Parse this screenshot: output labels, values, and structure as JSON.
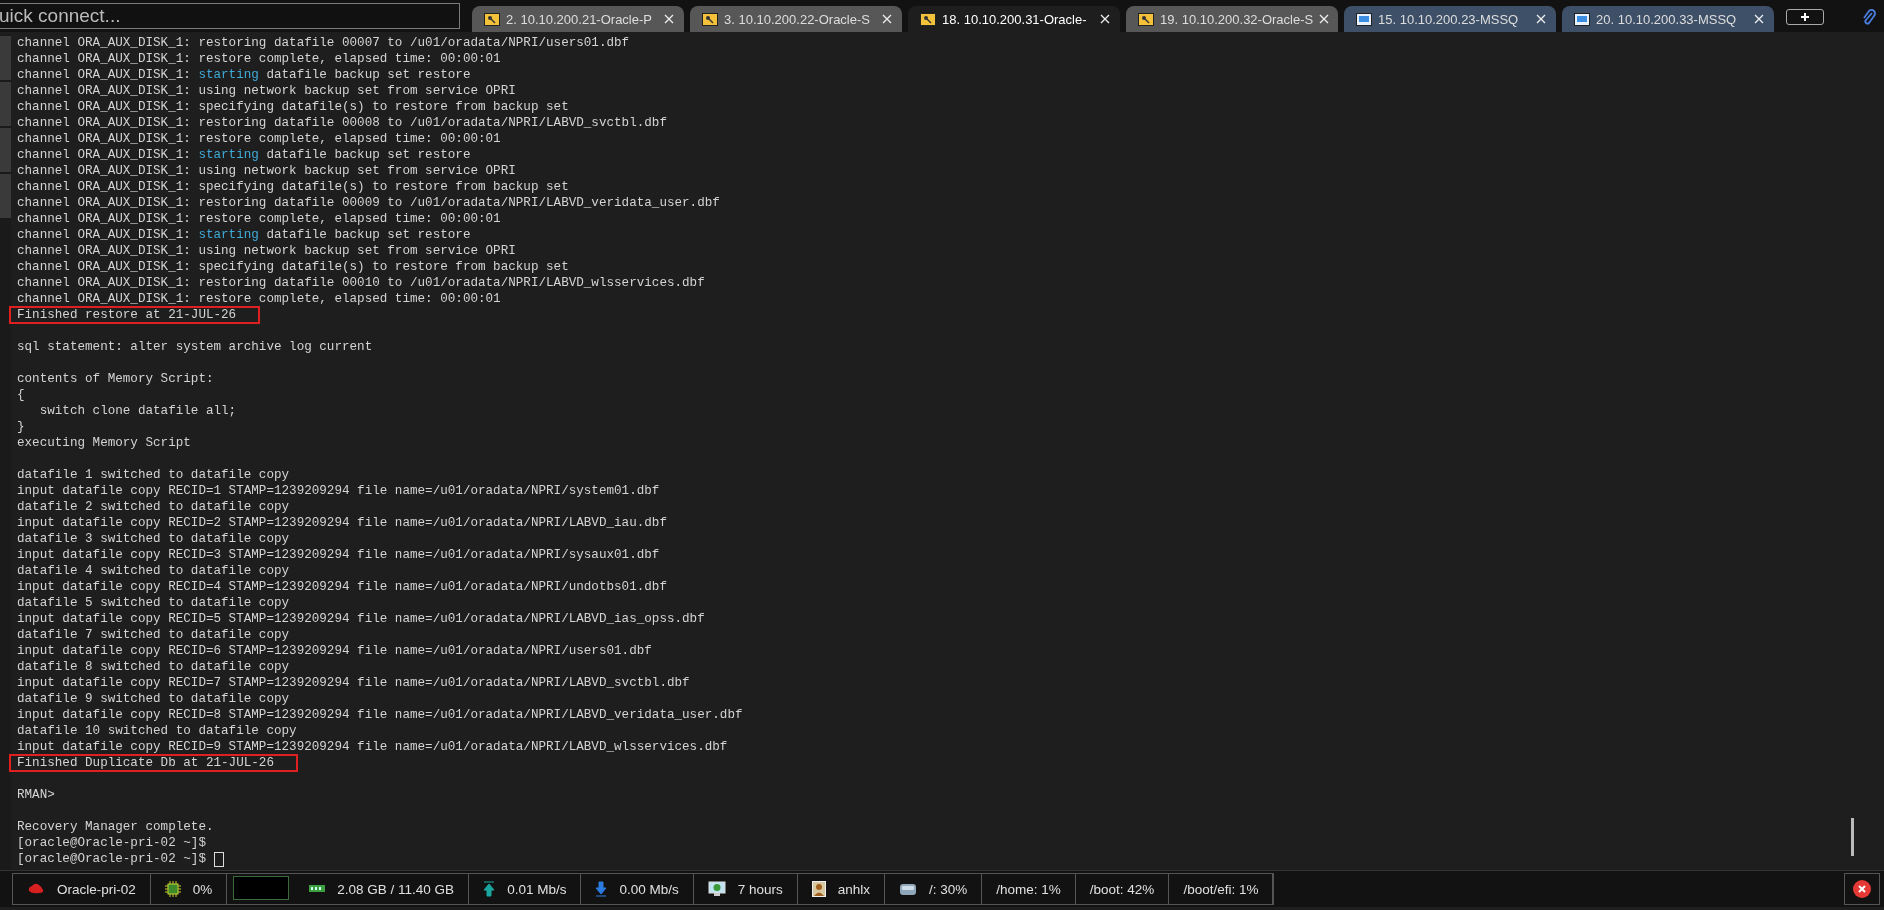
{
  "quick_connect": {
    "placeholder": "uick connect..."
  },
  "tabs": [
    {
      "label": "2. 10.10.200.21-Oracle-P",
      "selected": false,
      "kind": "ssh"
    },
    {
      "label": "3. 10.10.200.22-Oracle-S",
      "selected": false,
      "kind": "ssh"
    },
    {
      "label": "18. 10.10.200.31-Oracle-",
      "selected": true,
      "kind": "ssh"
    },
    {
      "label": "19. 10.10.200.32-Oracle-S",
      "selected": false,
      "kind": "ssh"
    },
    {
      "label": "15. 10.10.200.23-MSSQ",
      "selected": false,
      "kind": "rdp"
    },
    {
      "label": "20. 10.10.200.33-MSSQ",
      "selected": false,
      "kind": "rdp"
    }
  ],
  "terminal": {
    "lines": [
      {
        "kind": "plain",
        "text": "channel ORA_AUX_DISK_1: restoring datafile 00007 to /u01/oradata/NPRI/users01.dbf"
      },
      {
        "kind": "plain",
        "text": "channel ORA_AUX_DISK_1: restore complete, elapsed time: 00:00:01"
      },
      {
        "kind": "keyword",
        "text": "channel ORA_AUX_DISK_1: ",
        "keyword": "starting",
        "rest": " datafile backup set restore"
      },
      {
        "kind": "plain",
        "text": "channel ORA_AUX_DISK_1: using network backup set from service OPRI"
      },
      {
        "kind": "plain",
        "text": "channel ORA_AUX_DISK_1: specifying datafile(s) to restore from backup set"
      },
      {
        "kind": "plain",
        "text": "channel ORA_AUX_DISK_1: restoring datafile 00008 to /u01/oradata/NPRI/LABVD_svctbl.dbf"
      },
      {
        "kind": "plain",
        "text": "channel ORA_AUX_DISK_1: restore complete, elapsed time: 00:00:01"
      },
      {
        "kind": "keyword",
        "text": "channel ORA_AUX_DISK_1: ",
        "keyword": "starting",
        "rest": " datafile backup set restore"
      },
      {
        "kind": "plain",
        "text": "channel ORA_AUX_DISK_1: using network backup set from service OPRI"
      },
      {
        "kind": "plain",
        "text": "channel ORA_AUX_DISK_1: specifying datafile(s) to restore from backup set"
      },
      {
        "kind": "plain",
        "text": "channel ORA_AUX_DISK_1: restoring datafile 00009 to /u01/oradata/NPRI/LABVD_veridata_user.dbf"
      },
      {
        "kind": "plain",
        "text": "channel ORA_AUX_DISK_1: restore complete, elapsed time: 00:00:01"
      },
      {
        "kind": "keyword",
        "text": "channel ORA_AUX_DISK_1: ",
        "keyword": "starting",
        "rest": " datafile backup set restore"
      },
      {
        "kind": "plain",
        "text": "channel ORA_AUX_DISK_1: using network backup set from service OPRI"
      },
      {
        "kind": "plain",
        "text": "channel ORA_AUX_DISK_1: specifying datafile(s) to restore from backup set"
      },
      {
        "kind": "plain",
        "text": "channel ORA_AUX_DISK_1: restoring datafile 00010 to /u01/oradata/NPRI/LABVD_wlsservices.dbf"
      },
      {
        "kind": "plain",
        "text": "channel ORA_AUX_DISK_1: restore complete, elapsed time: 00:00:01"
      },
      {
        "kind": "boxed",
        "text": "Finished restore at 21-JUL-26"
      },
      {
        "kind": "blank"
      },
      {
        "kind": "plain",
        "text": "sql statement: alter system archive log current"
      },
      {
        "kind": "blank"
      },
      {
        "kind": "plain",
        "text": "contents of Memory Script:"
      },
      {
        "kind": "plain",
        "text": "{"
      },
      {
        "kind": "plain",
        "text": "   switch clone datafile all;"
      },
      {
        "kind": "plain",
        "text": "}"
      },
      {
        "kind": "plain",
        "text": "executing Memory Script"
      },
      {
        "kind": "blank"
      },
      {
        "kind": "plain",
        "text": "datafile 1 switched to datafile copy"
      },
      {
        "kind": "plain",
        "text": "input datafile copy RECID=1 STAMP=1239209294 file name=/u01/oradata/NPRI/system01.dbf"
      },
      {
        "kind": "plain",
        "text": "datafile 2 switched to datafile copy"
      },
      {
        "kind": "plain",
        "text": "input datafile copy RECID=2 STAMP=1239209294 file name=/u01/oradata/NPRI/LABVD_iau.dbf"
      },
      {
        "kind": "plain",
        "text": "datafile 3 switched to datafile copy"
      },
      {
        "kind": "plain",
        "text": "input datafile copy RECID=3 STAMP=1239209294 file name=/u01/oradata/NPRI/sysaux01.dbf"
      },
      {
        "kind": "plain",
        "text": "datafile 4 switched to datafile copy"
      },
      {
        "kind": "plain",
        "text": "input datafile copy RECID=4 STAMP=1239209294 file name=/u01/oradata/NPRI/undotbs01.dbf"
      },
      {
        "kind": "plain",
        "text": "datafile 5 switched to datafile copy"
      },
      {
        "kind": "plain",
        "text": "input datafile copy RECID=5 STAMP=1239209294 file name=/u01/oradata/NPRI/LABVD_ias_opss.dbf"
      },
      {
        "kind": "plain",
        "text": "datafile 7 switched to datafile copy"
      },
      {
        "kind": "plain",
        "text": "input datafile copy RECID=6 STAMP=1239209294 file name=/u01/oradata/NPRI/users01.dbf"
      },
      {
        "kind": "plain",
        "text": "datafile 8 switched to datafile copy"
      },
      {
        "kind": "plain",
        "text": "input datafile copy RECID=7 STAMP=1239209294 file name=/u01/oradata/NPRI/LABVD_svctbl.dbf"
      },
      {
        "kind": "plain",
        "text": "datafile 9 switched to datafile copy"
      },
      {
        "kind": "plain",
        "text": "input datafile copy RECID=8 STAMP=1239209294 file name=/u01/oradata/NPRI/LABVD_veridata_user.dbf"
      },
      {
        "kind": "plain",
        "text": "datafile 10 switched to datafile copy"
      },
      {
        "kind": "plain",
        "text": "input datafile copy RECID=9 STAMP=1239209294 file name=/u01/oradata/NPRI/LABVD_wlsservices.dbf"
      },
      {
        "kind": "boxed",
        "text": "Finished Duplicate Db at 21-JUL-26"
      },
      {
        "kind": "blank"
      },
      {
        "kind": "plain",
        "text": "RMAN>"
      },
      {
        "kind": "blank"
      },
      {
        "kind": "plain",
        "text": "Recovery Manager complete."
      },
      {
        "kind": "plain",
        "text": "[oracle@Oracle-pri-02 ~]$"
      },
      {
        "kind": "cursor",
        "text": "[oracle@Oracle-pri-02 ~]$ "
      }
    ]
  },
  "status_bar": [
    {
      "kind": "host",
      "text": "Oracle-pri-02"
    },
    {
      "kind": "cpu",
      "text": "0%"
    },
    {
      "kind": "memory",
      "text": "2.08 GB / 11.40 GB"
    },
    {
      "kind": "upload",
      "text": "0.01 Mb/s"
    },
    {
      "kind": "download",
      "text": "0.00 Mb/s"
    },
    {
      "kind": "uptime",
      "text": "7 hours"
    },
    {
      "kind": "user",
      "text": "anhlx"
    },
    {
      "kind": "disk",
      "text": "/: 30%"
    },
    {
      "kind": "plain",
      "text": "/home: 1%"
    },
    {
      "kind": "plain",
      "text": "/boot: 42%"
    },
    {
      "kind": "plain",
      "text": "/boot/efi: 1%"
    }
  ]
}
